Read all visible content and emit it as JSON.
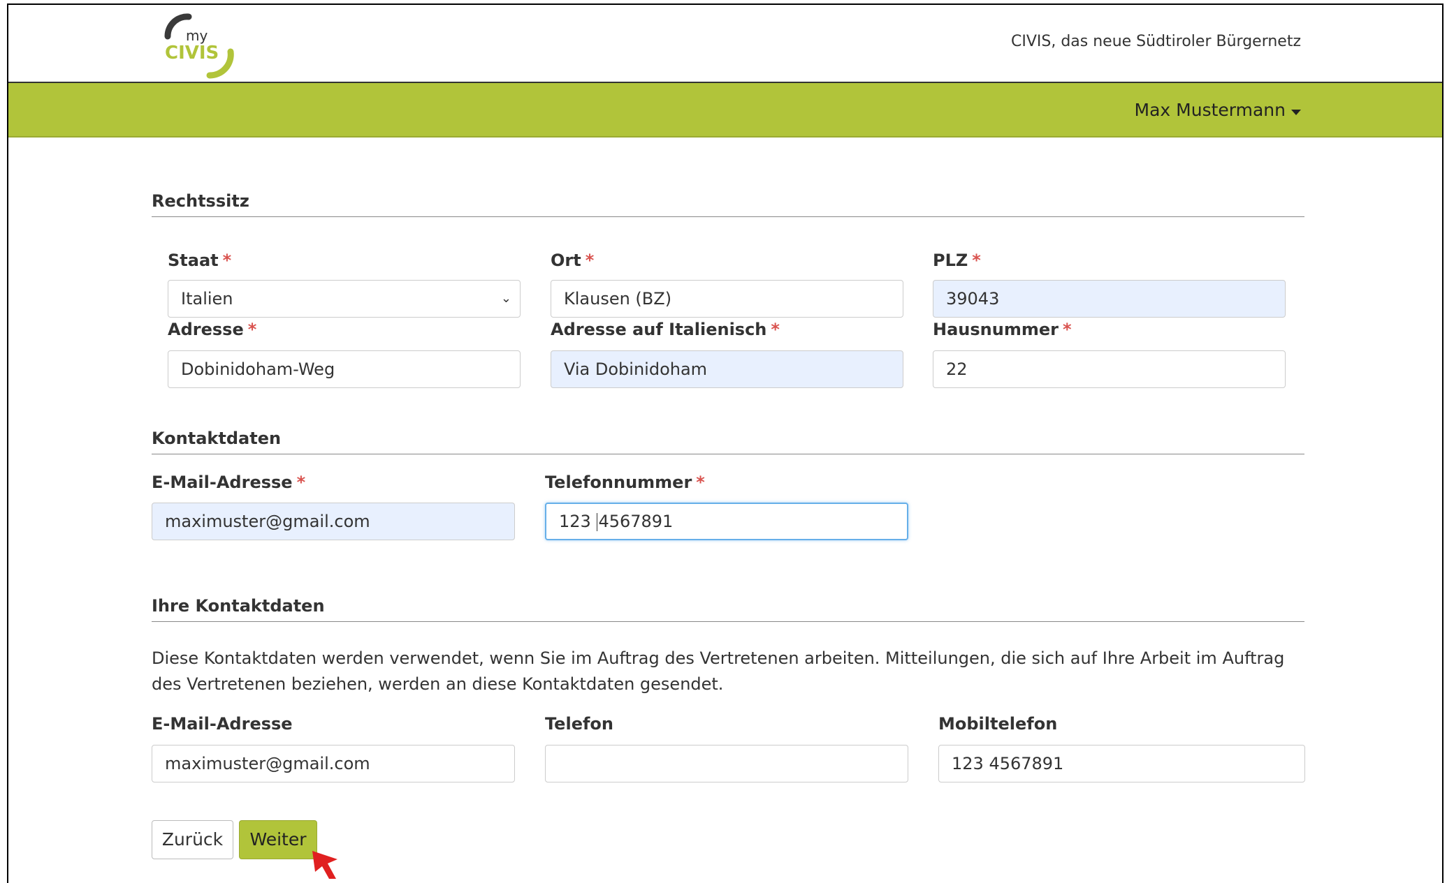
{
  "header": {
    "logo_text_top": "my",
    "logo_text_bottom": "CIVIS",
    "tagline": "CIVIS, das neue Südtiroler Bürgernetz",
    "user_name": "Max Mustermann"
  },
  "colors": {
    "brand_green": "#b1c43a",
    "required_star": "#d9534f",
    "autofill_bg": "#e8f0fe"
  },
  "rechtssitz": {
    "title": "Rechtssitz",
    "staat": {
      "label": "Staat",
      "value": "Italien"
    },
    "ort": {
      "label": "Ort",
      "value": "Klausen (BZ)"
    },
    "plz": {
      "label": "PLZ",
      "value": "39043"
    },
    "adresse": {
      "label": "Adresse",
      "value": "Dobinidoham-Weg"
    },
    "adresse_it": {
      "label": "Adresse auf Italienisch",
      "value": "Via Dobinidoham"
    },
    "hausnummer": {
      "label": "Hausnummer",
      "value": "22"
    }
  },
  "kontaktdaten": {
    "title": "Kontaktdaten",
    "email": {
      "label": "E-Mail-Adresse",
      "value": "maximuster@gmail.com"
    },
    "telefon": {
      "label": "Telefonnummer",
      "value_before_caret": "123 ",
      "value_after_caret": "4567891"
    }
  },
  "ihre_kontaktdaten": {
    "title": "Ihre Kontaktdaten",
    "description": "Diese Kontaktdaten werden verwendet, wenn Sie im Auftrag des Vertretenen arbeiten. Mitteilungen, die sich auf Ihre Arbeit im Auftrag des Vertretenen beziehen, werden an diese Kontaktdaten gesendet.",
    "email": {
      "label": "E-Mail-Adresse",
      "value": "maximuster@gmail.com"
    },
    "telefon": {
      "label": "Telefon",
      "value": ""
    },
    "mobil": {
      "label": "Mobiltelefon",
      "value": "123 4567891"
    }
  },
  "buttons": {
    "back": "Zurück",
    "next": "Weiter"
  },
  "required_mark": "*"
}
